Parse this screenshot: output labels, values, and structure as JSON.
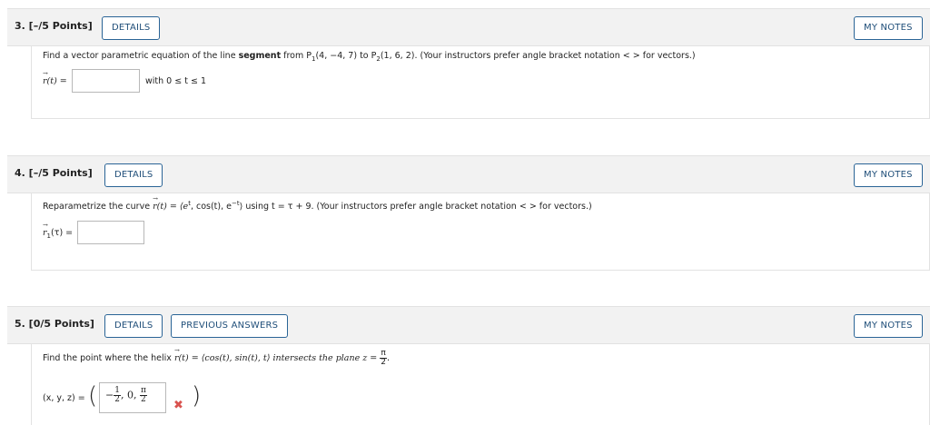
{
  "questions": [
    {
      "number_label": "3. [–/5 Points]",
      "details_label": "DETAILS",
      "notes_label": "MY NOTES",
      "prompt_pre": "Find a vector parametric equation of the line ",
      "prompt_bold": "segment",
      "prompt_mid": " from P",
      "p1_sub": "1",
      "p1_coords": "(4, −4, 7) to P",
      "p2_sub": "2",
      "p2_coords": "(1, 6, 2). (Your instructors prefer angle bracket notation < > for vectors.)",
      "answer_label": "r(t) =",
      "answer_value": "",
      "range_text": "with 0 ≤ t ≤ 1"
    },
    {
      "number_label": "4. [–/5 Points]",
      "details_label": "DETAILS",
      "notes_label": "MY NOTES",
      "prompt_pre": "Reparametrize the curve ",
      "curve": "r(t) = ⟨e",
      "curve_sup1": "t",
      "curve_mid": ", cos(t), e",
      "curve_sup2": "−t",
      "curve_end": "⟩ using t = τ + 9. (Your instructors prefer angle bracket notation < > for vectors.)",
      "answer_label_sub": "1",
      "answer_label": "(τ) =",
      "answer_value": ""
    },
    {
      "number_label": "5. [0/5 Points]",
      "details_label": "DETAILS",
      "prev_label": "PREVIOUS ANSWERS",
      "notes_label": "MY NOTES",
      "prompt_pre": "Find the point where the helix ",
      "helix": "r(t) = ⟨cos(t), sin(t), t⟩ intersects the plane z = ",
      "plane_num": "π",
      "plane_den": "2",
      "answer_label": "(x, y, z) =",
      "ans_neg": "−",
      "ans_x_num": "1",
      "ans_x_den": "2",
      "ans_y": "0,",
      "ans_z_num": "π",
      "ans_z_den": "2",
      "status": "incorrect",
      "status_color": "#d9534f"
    }
  ]
}
